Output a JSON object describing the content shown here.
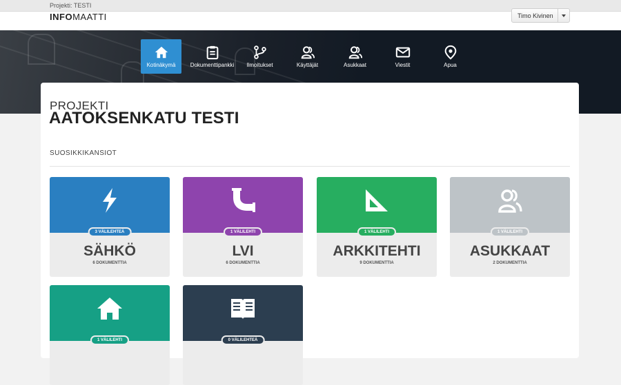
{
  "topbar": {
    "project_label": "Projekti: TESTI"
  },
  "logo": {
    "bold": "INFO",
    "light": "MAATTI"
  },
  "user_menu": {
    "name": "Timo Kivinen"
  },
  "nav": {
    "items": [
      {
        "label": "Kotinäkymä",
        "icon": "home-icon",
        "active": true
      },
      {
        "label": "Dokumenttipankki",
        "icon": "clipboard-icon"
      },
      {
        "label": "Ilmoitukset",
        "icon": "branch-icon"
      },
      {
        "label": "Käyttäjät",
        "icon": "users-icon"
      },
      {
        "label": "Asukkaat",
        "icon": "users-icon"
      },
      {
        "label": "Viestit",
        "icon": "envelope-icon"
      },
      {
        "label": "Apua",
        "icon": "map-pin-icon"
      }
    ]
  },
  "page": {
    "title_small": "PROJEKTI",
    "title_big": "AATOKSENKATU TESTI",
    "section_title": "SUOSIKKIKANSIOT"
  },
  "folders": [
    {
      "name": "SÄHKÖ",
      "badge": "3 VÄLILEHTEÄ",
      "docs": "6 DOKUMENTTIA",
      "icon": "lightning-icon",
      "color": "#2a7fc1"
    },
    {
      "name": "LVI",
      "badge": "1 VÄLILEHTI",
      "docs": "6 DOKUMENTTIA",
      "icon": "pipe-icon",
      "color": "#8e44ad"
    },
    {
      "name": "ARKKITEHTI",
      "badge": "1 VÄLILEHTI",
      "docs": "9 DOKUMENTTIA",
      "icon": "set-square-icon",
      "color": "#27ae60"
    },
    {
      "name": "ASUKKAAT",
      "badge": "1 VÄLILEHTI",
      "docs": "2 DOKUMENTTIA",
      "icon": "users-icon",
      "color": "#bdc3c7"
    },
    {
      "name": "",
      "badge": "1 VÄLILEHTI",
      "docs": "",
      "icon": "home-icon",
      "color": "#16a085"
    },
    {
      "name": "",
      "badge": "0 VÄLILEHTEÄ",
      "docs": "",
      "icon": "book-icon",
      "color": "#2c3e50"
    }
  ]
}
